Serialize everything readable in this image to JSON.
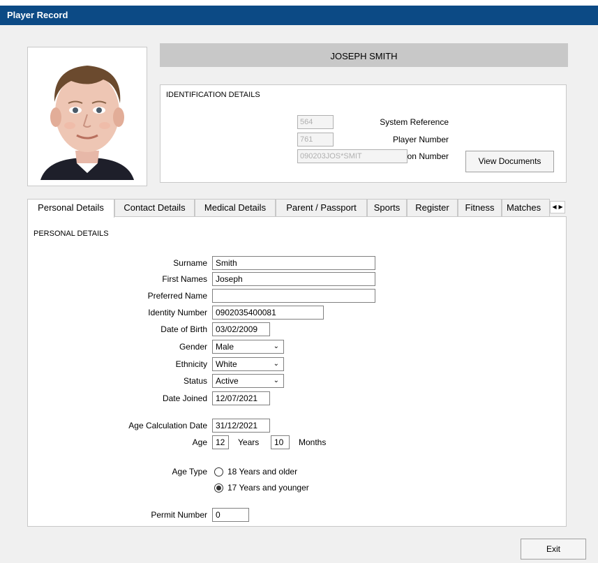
{
  "window": {
    "title": "Player Record"
  },
  "player": {
    "name": "JOSEPH SMITH"
  },
  "identification": {
    "heading": "IDENTIFICATION DETAILS",
    "system_reference_label": "System Reference",
    "system_reference_value": "564",
    "player_number_label": "Player Number",
    "player_number_value": "761",
    "registration_number_label": "Registration Number",
    "registration_number_value": "090203JOS*SMIT",
    "view_documents_label": "View Documents"
  },
  "tabs": [
    {
      "label": "Personal Details"
    },
    {
      "label": "Contact Details"
    },
    {
      "label": "Medical Details"
    },
    {
      "label": "Parent / Passport"
    },
    {
      "label": "Sports"
    },
    {
      "label": "Register"
    },
    {
      "label": "Fitness"
    },
    {
      "label": "Matches"
    }
  ],
  "tab_scroll": {
    "left_icon": "triangle-left-icon",
    "right_icon": "triangle-right-icon"
  },
  "personal": {
    "heading": "PERSONAL DETAILS",
    "surname_label": "Surname",
    "surname_value": "Smith",
    "first_names_label": "First Names",
    "first_names_value": "Joseph",
    "preferred_name_label": "Preferred Name",
    "preferred_name_value": "",
    "identity_number_label": "Identity Number",
    "identity_number_value": "0902035400081",
    "dob_label": "Date of Birth",
    "dob_value": "03/02/2009",
    "gender_label": "Gender",
    "gender_value": "Male",
    "ethnicity_label": "Ethnicity",
    "ethnicity_value": "White",
    "status_label": "Status",
    "status_value": "Active",
    "date_joined_label": "Date Joined",
    "date_joined_value": "12/07/2021",
    "age_calc_label": "Age Calculation Date",
    "age_calc_value": "31/12/2021",
    "age_label": "Age",
    "age_years_value": "12",
    "years_label": "Years",
    "age_months_value": "10",
    "months_label": "Months",
    "age_type_label": "Age Type",
    "age_type_option1": "18 Years and older",
    "age_type_option2": "17 Years and younger",
    "age_type_selected": 2,
    "permit_label": "Permit Number",
    "permit_value": "0"
  },
  "footer": {
    "exit_label": "Exit"
  }
}
